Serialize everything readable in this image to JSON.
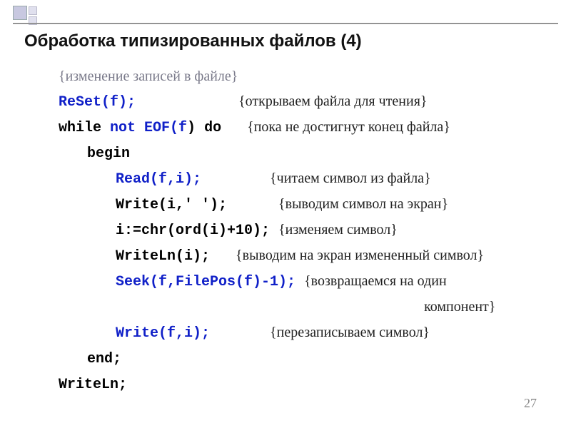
{
  "title": "Обработка типизированных файлов (4)",
  "page_number": "27",
  "lines": {
    "l0_comment": "{изменение записей в файле}",
    "l1_code": "ReSet(f);",
    "l1_pad": "            ",
    "l1_comment": "{открываем файла для чтения}",
    "l2a": "while ",
    "l2b": "not EOF(f",
    "l2c": ") ",
    "l2d": "do",
    "l2_pad": "   ",
    "l2_comment": "{пока не достигнут конец файла}",
    "l3": "begin",
    "l4_code": "Read(f,i);",
    "l4_pad": "        ",
    "l4_comment": "{читаем символ из файла}",
    "l5_code": "Write(i,' ');",
    "l5_pad": "      ",
    "l5_comment": "{выводим символ на экран}",
    "l6_code": "i:=chr(ord(i)+10);",
    "l6_pad": " ",
    "l6_comment": "{изменяем символ}",
    "l7_code": "WriteLn(i);",
    "l7_pad": "   ",
    "l7_comment": "{выводим на экран измененный символ}",
    "l8_code": "Seek(f,FilePos(f)-1);",
    "l8_pad": " ",
    "l8_comment": "{возвращаемся на один",
    "l8b_pad": "                                    ",
    "l8b_comment": "компонент}",
    "l9_code": "Write(f,i);",
    "l9_pad": "       ",
    "l9_comment": "{перезаписываем символ}",
    "l10": "end;",
    "l11": "WriteLn;"
  }
}
